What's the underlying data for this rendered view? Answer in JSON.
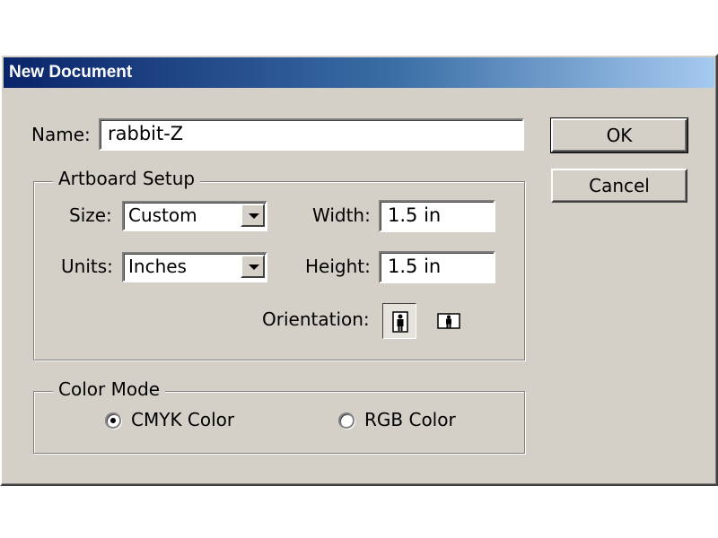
{
  "window": {
    "title": "New Document"
  },
  "name_field": {
    "label": "Name:",
    "value": "rabbit-Z"
  },
  "buttons": {
    "ok": "OK",
    "cancel": "Cancel"
  },
  "artboard": {
    "legend": "Artboard Setup",
    "size": {
      "label": "Size:",
      "selected": "Custom"
    },
    "units": {
      "label": "Units:",
      "selected": "Inches"
    },
    "width": {
      "label": "Width:",
      "value": "1.5 in"
    },
    "height": {
      "label": "Height:",
      "value": "1.5 in"
    },
    "orientation": {
      "label": "Orientation:",
      "selected": "portrait",
      "options": [
        "portrait-icon",
        "landscape-icon"
      ]
    }
  },
  "color_mode": {
    "legend": "Color Mode",
    "options": [
      {
        "label": "CMYK Color",
        "checked": true
      },
      {
        "label": "RGB Color",
        "checked": false
      }
    ]
  }
}
